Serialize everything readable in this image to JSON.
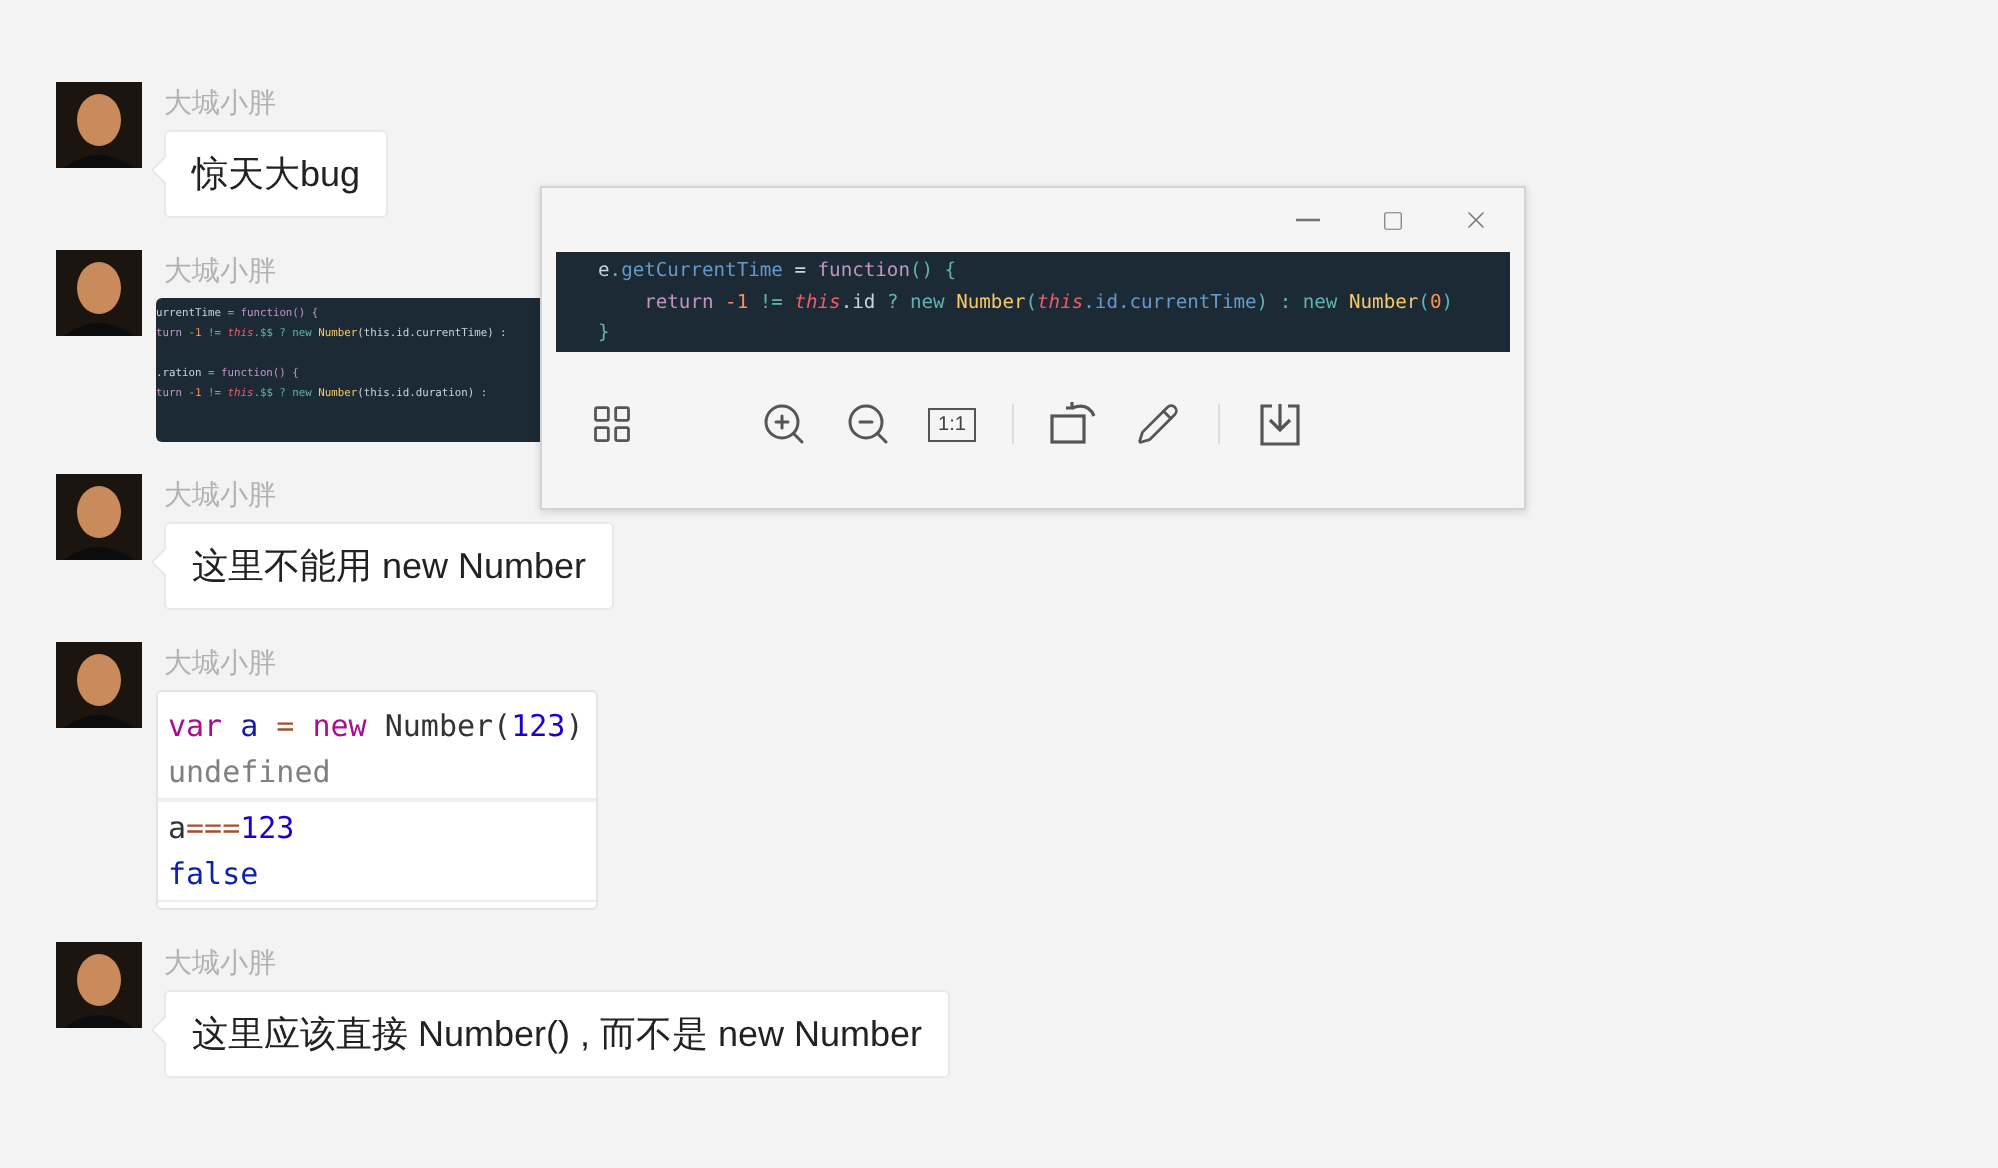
{
  "messages": [
    {
      "sender": "大城小胖",
      "kind": "text",
      "text": "惊天大bug"
    },
    {
      "sender": "大城小胖",
      "kind": "image",
      "lines": [
        {
          "blank_before": false,
          "tokens": [
            {
              "t": "urrentTime",
              "kind": "plain"
            },
            {
              "t": " = ",
              "kind": "punct"
            },
            {
              "t": "function() {",
              "kind": "keyword"
            }
          ]
        },
        {
          "blank_before": false,
          "tokens": [
            {
              "t": "turn ",
              "kind": "keyword"
            },
            {
              "t": "-1",
              "kind": "number"
            },
            {
              "t": " != ",
              "kind": "punct"
            },
            {
              "t": "this",
              "kind": "this"
            },
            {
              "t": ".$$ ? new ",
              "kind": "punct"
            },
            {
              "t": "Number",
              "kind": "class"
            },
            {
              "t": "(this.id.currentTime) :",
              "kind": "plain"
            }
          ]
        },
        {
          "blank_before": true,
          "tokens": [
            {
              "t": ".ration",
              "kind": "plain"
            },
            {
              "t": " = ",
              "kind": "punct"
            },
            {
              "t": "function() {",
              "kind": "keyword"
            }
          ]
        },
        {
          "blank_before": false,
          "tokens": [
            {
              "t": "turn ",
              "kind": "keyword"
            },
            {
              "t": "-1",
              "kind": "number"
            },
            {
              "t": " != ",
              "kind": "punct"
            },
            {
              "t": "this",
              "kind": "this"
            },
            {
              "t": ".$$ ? new ",
              "kind": "punct"
            },
            {
              "t": "Number",
              "kind": "class"
            },
            {
              "t": "(this.id.duration) :",
              "kind": "plain"
            }
          ]
        }
      ]
    },
    {
      "sender": "大城小胖",
      "kind": "text",
      "text": "这里不能用 new Number"
    },
    {
      "sender": "大城小胖",
      "kind": "console",
      "entries": [
        [
          [
            {
              "t": "var",
              "kind": "keyword"
            },
            {
              "t": " a",
              "kind": "variable"
            },
            {
              "t": " = ",
              "kind": "operator"
            },
            {
              "t": "new",
              "kind": "keyword"
            },
            {
              "t": " Number(",
              "kind": "plain"
            },
            {
              "t": "123",
              "kind": "number"
            },
            {
              "t": ")",
              "kind": "plain"
            }
          ],
          [
            {
              "t": "undefined",
              "kind": "result"
            }
          ]
        ],
        [
          [
            {
              "t": "a",
              "kind": "plain"
            },
            {
              "t": "===",
              "kind": "operator"
            },
            {
              "t": "123",
              "kind": "number"
            }
          ],
          [
            {
              "t": "false",
              "kind": "boolean"
            }
          ]
        ]
      ]
    },
    {
      "sender": "大城小胖",
      "kind": "text",
      "text": "这里应该直接 Number() , 而不是 new Number"
    }
  ],
  "viewer": {
    "code": [
      [
        {
          "t": "e",
          "kind": "plain"
        },
        {
          "t": ".",
          "kind": "punct"
        },
        {
          "t": "getCurrentTime",
          "kind": "func"
        },
        {
          "t": " = ",
          "kind": "plain"
        },
        {
          "t": "function",
          "kind": "keyword"
        },
        {
          "t": "() {",
          "kind": "punct"
        }
      ],
      [
        {
          "t": "    return ",
          "kind": "keyword"
        },
        {
          "t": "-1",
          "kind": "number"
        },
        {
          "t": " != ",
          "kind": "punct"
        },
        {
          "t": "this",
          "kind": "this"
        },
        {
          "t": ".id ",
          "kind": "plain"
        },
        {
          "t": "? new ",
          "kind": "punct"
        },
        {
          "t": "Number",
          "kind": "class"
        },
        {
          "t": "(",
          "kind": "punct"
        },
        {
          "t": "this",
          "kind": "this"
        },
        {
          "t": ".id.currentTime",
          "kind": "func"
        },
        {
          "t": ") : new ",
          "kind": "punct"
        },
        {
          "t": "Number",
          "kind": "class"
        },
        {
          "t": "(",
          "kind": "punct"
        },
        {
          "t": "0",
          "kind": "number"
        },
        {
          "t": ")",
          "kind": "punct"
        }
      ],
      [
        {
          "t": "}",
          "kind": "punct"
        }
      ]
    ],
    "tools": [
      {
        "kind": "grid"
      },
      {
        "kind": "gap"
      },
      {
        "kind": "zoom-in"
      },
      {
        "kind": "zoom-out"
      },
      {
        "kind": "actual-size",
        "label": "1:1"
      },
      {
        "kind": "divider"
      },
      {
        "kind": "rotate"
      },
      {
        "kind": "pencil"
      },
      {
        "kind": "divider"
      },
      {
        "kind": "download"
      }
    ]
  }
}
